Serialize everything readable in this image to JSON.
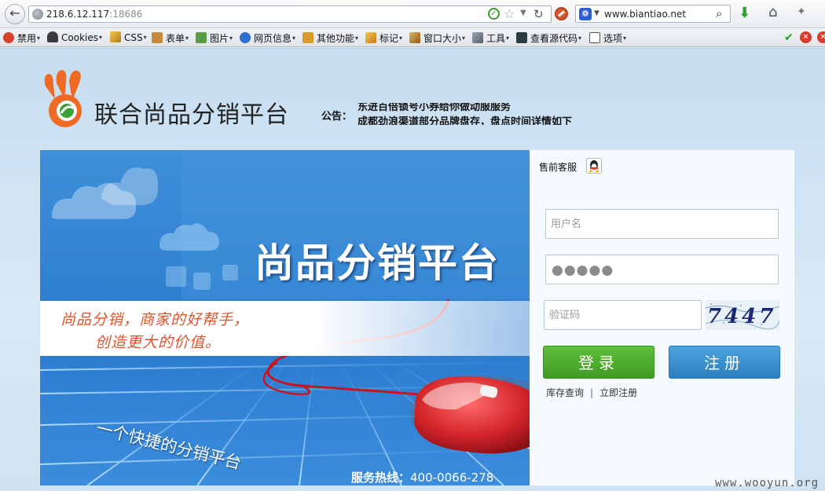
{
  "browser": {
    "url_host": "218.6.12.117",
    "url_port": ":18686",
    "search_engine_site": "www.biantiao.net"
  },
  "devbar": {
    "items": [
      "禁用",
      "Cookies",
      "CSS",
      "表单",
      "图片",
      "网页信息",
      "其他功能",
      "标记",
      "窗口大小",
      "工具",
      "查看源代码",
      "选项"
    ]
  },
  "header": {
    "brand": "联合尚品分销平台",
    "notice_label": "公告：",
    "notice_lines": [
      "东进百倍锁号小券给你做动服服务",
      "成都劲浪渠道部分品牌盘存，盘点时间详情如下"
    ]
  },
  "banner": {
    "title": "尚品分销平台",
    "slogan_1": "尚品分销，商家的好帮手，",
    "slogan_2": "创造更大的价值。",
    "tagline": "一个快捷的分销平台",
    "hotline_label": "服务热线：",
    "hotline_number": "400-0066-278"
  },
  "login": {
    "service_label": "售前客服",
    "username_placeholder": "用户名",
    "password_mask": "●●●●●",
    "captcha_placeholder": "验证码",
    "captcha_code": "7447",
    "login_button": "登录",
    "register_button": "注册",
    "link_inventory": "库存查询",
    "link_separator": "|",
    "link_register": "立即注册"
  },
  "watermark": "www.wooyun.org",
  "colors": {
    "login_green": "#4aab2c",
    "register_blue": "#3a91cf",
    "slogan_orange": "#e2512b",
    "banner_blue": "#2f7fd0",
    "logo_orange": "#ef6a25"
  }
}
